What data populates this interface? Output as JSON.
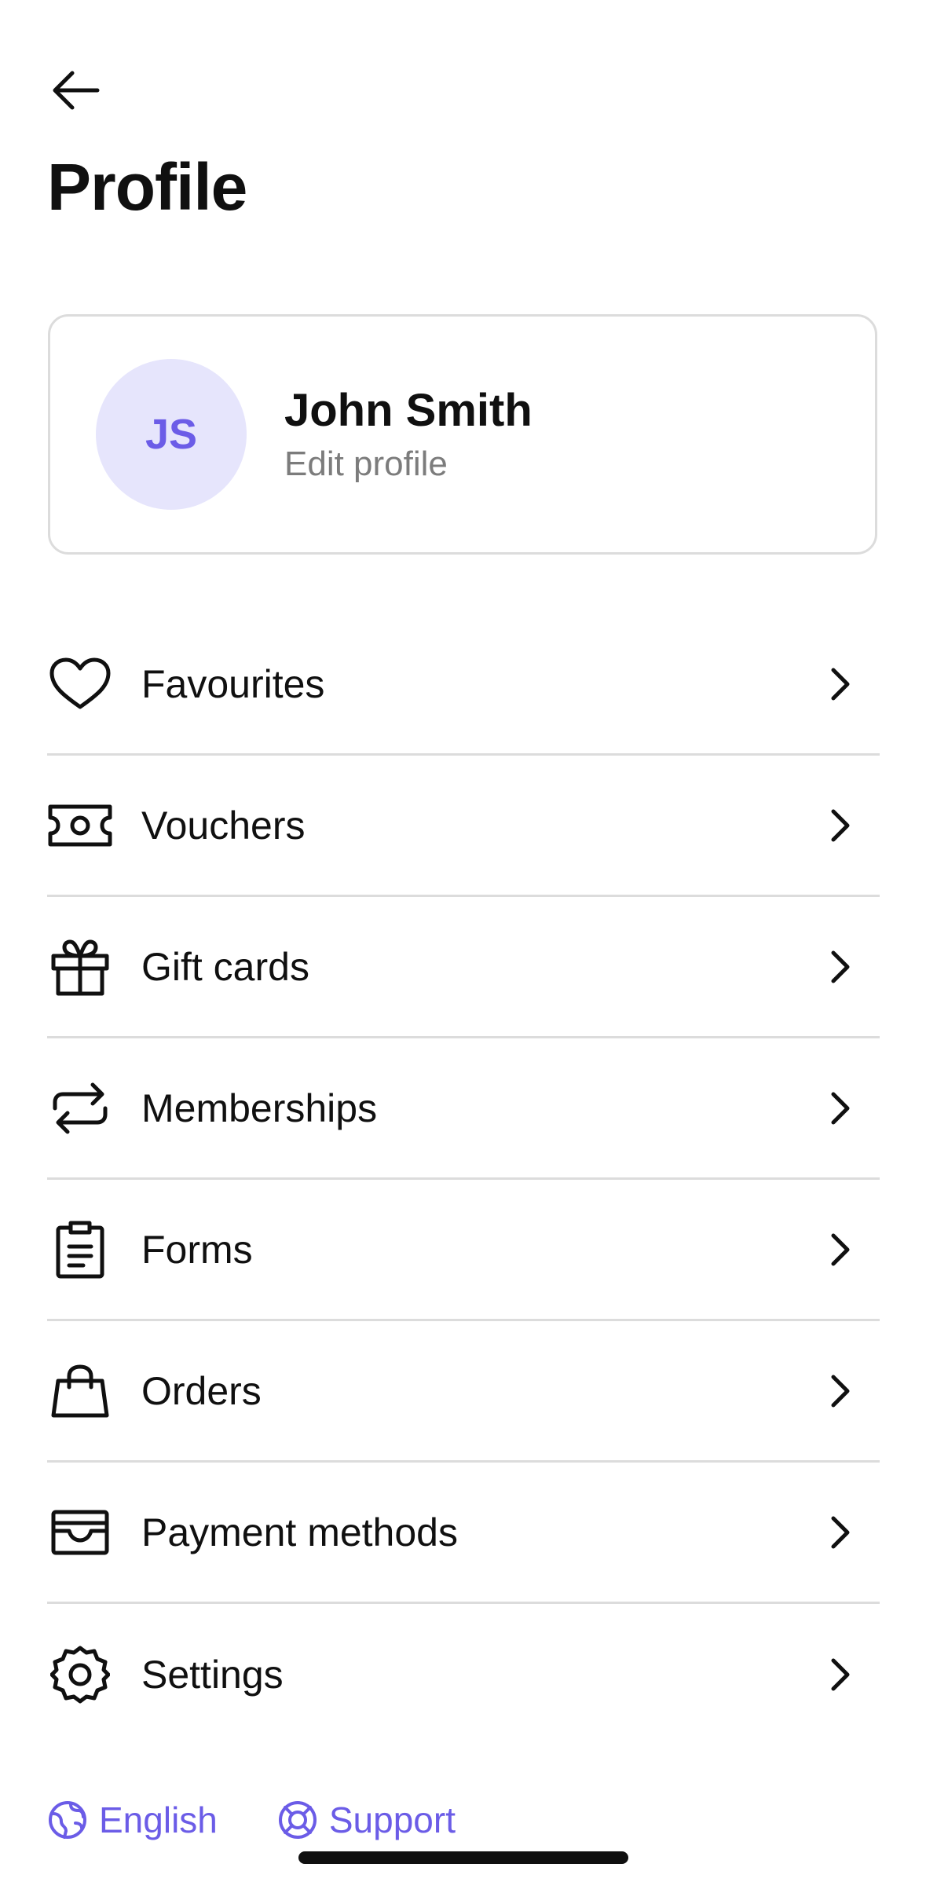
{
  "header": {
    "back_icon": "arrow-left-icon",
    "title": "Profile"
  },
  "profile": {
    "initials": "JS",
    "name": "John Smith",
    "subtitle": "Edit profile",
    "avatar_bg": "#e6e5fc",
    "avatar_fg": "#6b5ce7"
  },
  "menu": {
    "items": [
      {
        "label": "Favourites",
        "icon": "heart-icon"
      },
      {
        "label": "Vouchers",
        "icon": "ticket-icon"
      },
      {
        "label": "Gift cards",
        "icon": "gift-icon"
      },
      {
        "label": "Memberships",
        "icon": "repeat-icon"
      },
      {
        "label": "Forms",
        "icon": "clipboard-icon"
      },
      {
        "label": "Orders",
        "icon": "shopping-bag-icon"
      },
      {
        "label": "Payment methods",
        "icon": "wallet-icon"
      },
      {
        "label": "Settings",
        "icon": "gear-icon"
      }
    ]
  },
  "footer": {
    "language": "English",
    "support": "Support",
    "accent": "#6b5ce7"
  }
}
